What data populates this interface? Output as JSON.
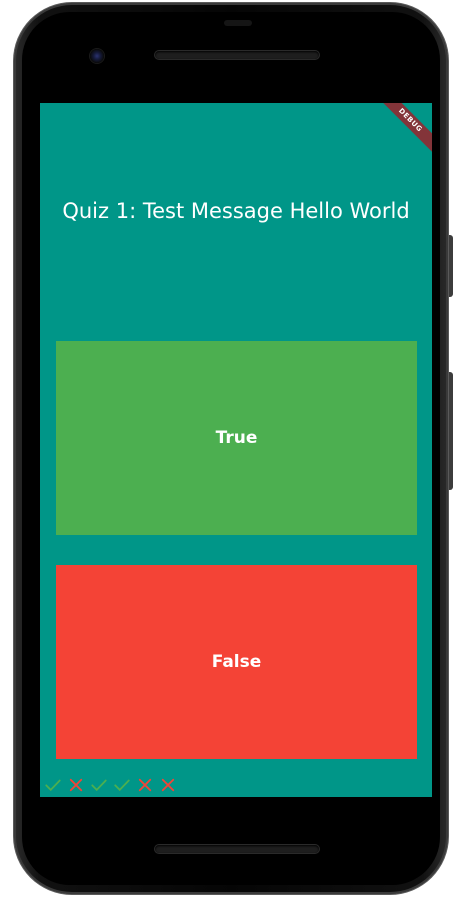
{
  "app": {
    "debug_banner": "DEBUG",
    "question": "Quiz 1: Test Message Hello World",
    "true_label": "True",
    "false_label": "False",
    "score_keeper": [
      {
        "icon": "check-icon",
        "result": "correct"
      },
      {
        "icon": "close-icon",
        "result": "wrong"
      },
      {
        "icon": "check-icon",
        "result": "correct"
      },
      {
        "icon": "check-icon",
        "result": "correct"
      },
      {
        "icon": "close-icon",
        "result": "wrong"
      },
      {
        "icon": "close-icon",
        "result": "wrong"
      }
    ]
  },
  "colors": {
    "background": "#009688",
    "true_button": "#4caf50",
    "false_button": "#f44336",
    "check": "#4caf50",
    "cross": "#f44336"
  }
}
